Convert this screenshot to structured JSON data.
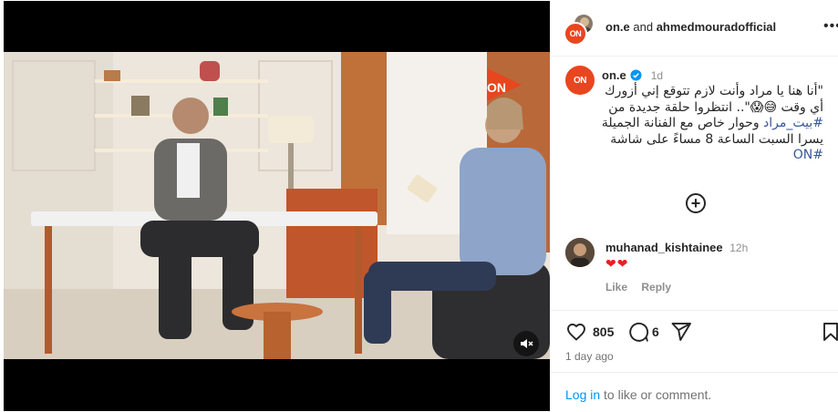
{
  "post": {
    "header": {
      "account": "on.e",
      "joiner": "and",
      "collaborator": "ahmedmouradofficial",
      "more_icon": "more-horizontal-icon"
    },
    "caption": {
      "username": "on.e",
      "verified": true,
      "time": "1d",
      "text_line1": "\"أنا هنا يا مراد وأنت لازم تتوقع إني أزورك",
      "text_line2": "أي وقت 😅😱\".. انتظروا حلقة جديدة من",
      "hashtag1": "#بيت_مراد",
      "text_line3": " وحوار خاص مع الفنانة الجميلة",
      "text_line4": "يسرا السبت الساعة 8 مساءً على شاشة",
      "hashtag2": "#ON"
    },
    "load_more_icon": "plus-circle-icon",
    "comment": {
      "username": "muhanad_kishtainee",
      "time": "12h",
      "text": "❤❤",
      "like_label": "Like",
      "reply_label": "Reply"
    },
    "actions": {
      "likes": "805",
      "comments": "6",
      "like_icon": "heart-icon",
      "comment_icon": "comment-icon",
      "share_icon": "send-icon",
      "save_icon": "bookmark-icon"
    },
    "time_ago": "1 day ago",
    "login": {
      "link": "Log in",
      "rest": " to like or comment."
    },
    "video": {
      "channel_logo": "ON",
      "mute_icon": "muted-speaker-icon"
    }
  },
  "colors": {
    "brand": "#e8461f",
    "link": "#0095f6",
    "hashtag": "#385898",
    "heart": "#ed1c24"
  }
}
